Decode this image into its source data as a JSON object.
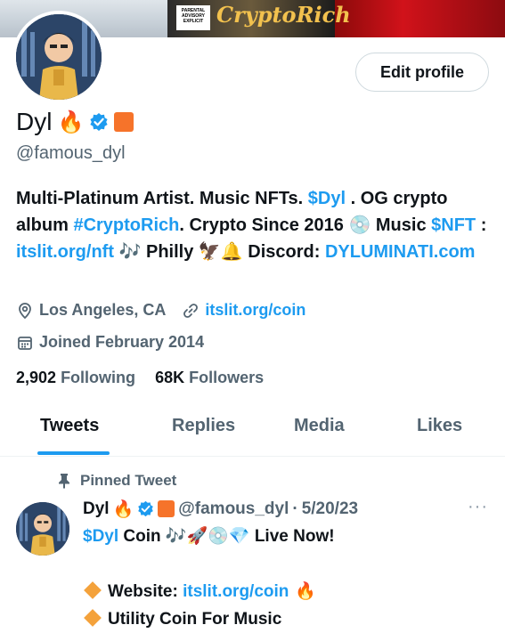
{
  "banner": {
    "advisory_text": "PARENTAL ADVISORY EXPLICIT CONTENT",
    "album_script": "CryptoRich"
  },
  "profile": {
    "edit_button": "Edit profile",
    "name": "Dyl",
    "name_emoji": "🔥",
    "handle": "@famous_dyl",
    "bio": {
      "part1": "Multi-Platinum Artist. Music NFTs. ",
      "cashtag1": "$Dyl",
      "part2": " . OG crypto album ",
      "hashtag": "#CryptoRich",
      "part3": ". Crypto Since 2016 💿 Music ",
      "cashtag2": "$NFT",
      "part4": " : ",
      "link1": "itslit.org/nft",
      "part5": " 🎶 Philly 🦅🔔 Discord: ",
      "link2": "DYLUMINATI.com"
    },
    "location": "Los Angeles, CA",
    "website": "itslit.org/coin",
    "joined": "Joined February 2014",
    "following_count": "2,902",
    "following_label": "Following",
    "followers_count": "68K",
    "followers_label": "Followers"
  },
  "tabs": [
    {
      "label": "Tweets",
      "active": true
    },
    {
      "label": "Replies",
      "active": false
    },
    {
      "label": "Media",
      "active": false
    },
    {
      "label": "Likes",
      "active": false
    }
  ],
  "pinned_tweet": {
    "pinned_label": "Pinned Tweet",
    "author_name": "Dyl",
    "author_emoji": "🔥",
    "author_handle": "@famous_dyl",
    "separator": "·",
    "date": "5/20/23",
    "more": "···",
    "line1_cashtag": "$Dyl",
    "line1_text": " Coin 🎶🚀💿💎 Live Now!",
    "line2_label": "Website: ",
    "line2_link": "itslit.org/coin",
    "line2_emoji": " 🔥",
    "line3_text": "Utility Coin For Music"
  },
  "colors": {
    "accent": "#1d9bf0",
    "secondary_text": "#536471",
    "orange_square": "#f6732a"
  },
  "icons": [
    "verified-badge-icon",
    "location-pin-icon",
    "link-icon",
    "calendar-icon",
    "pin-icon",
    "more-icon"
  ]
}
